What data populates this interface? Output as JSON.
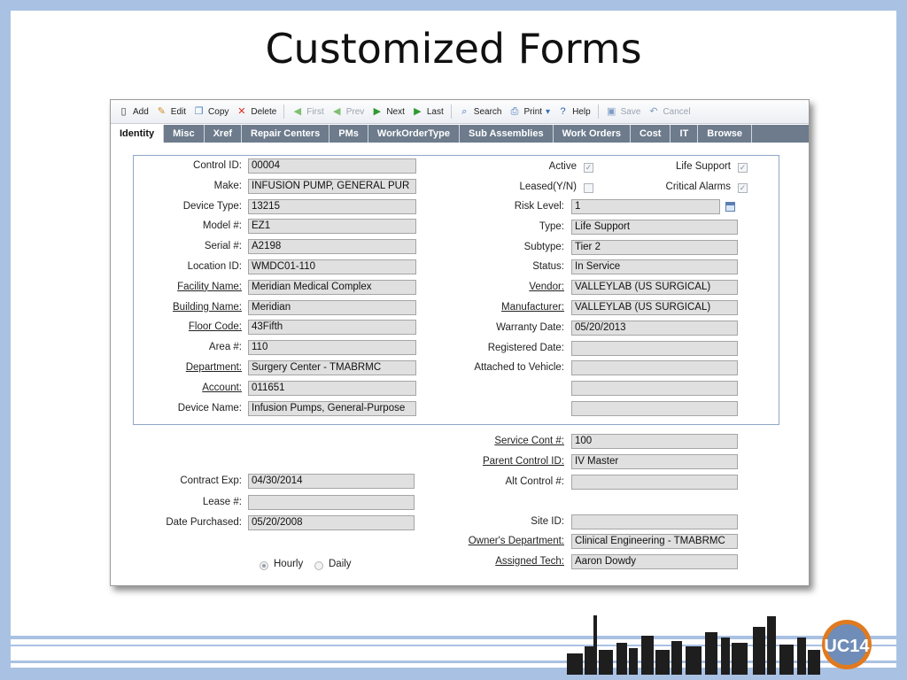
{
  "slide_title": "Customized Forms",
  "toolbar": [
    {
      "label": "Add",
      "icon": "add-icon",
      "glyph": "▯",
      "color": "#333",
      "disabled": false
    },
    {
      "label": "Edit",
      "icon": "edit-icon",
      "glyph": "✎",
      "color": "#d08a1e",
      "disabled": false
    },
    {
      "label": "Copy",
      "icon": "copy-icon",
      "glyph": "❐",
      "color": "#4a7cc0",
      "disabled": false
    },
    {
      "label": "Delete",
      "icon": "delete-icon",
      "glyph": "✕",
      "color": "#e02a1a",
      "disabled": false
    },
    {
      "label": "First",
      "icon": "first-icon",
      "glyph": "◀",
      "color": "#7fbf6f",
      "disabled": true
    },
    {
      "label": "Prev",
      "icon": "prev-icon",
      "glyph": "◀",
      "color": "#7fbf6f",
      "disabled": true
    },
    {
      "label": "Next",
      "icon": "next-icon",
      "glyph": "▶",
      "color": "#2f9a2f",
      "disabled": false
    },
    {
      "label": "Last",
      "icon": "last-icon",
      "glyph": "▶",
      "color": "#2f9a2f",
      "disabled": false
    },
    {
      "label": "Search",
      "icon": "search-icon",
      "glyph": "⌕",
      "color": "#3a6fb5",
      "disabled": false
    },
    {
      "label": "Print",
      "icon": "print-icon",
      "glyph": "⎙",
      "color": "#3a6fb5",
      "disabled": false
    },
    {
      "label": "Help",
      "icon": "help-icon",
      "glyph": "?",
      "color": "#2a5fb0",
      "disabled": false
    },
    {
      "label": "Save",
      "icon": "save-icon",
      "glyph": "▣",
      "color": "#7e9cc6",
      "disabled": true
    },
    {
      "label": "Cancel",
      "icon": "cancel-icon",
      "glyph": "↶",
      "color": "#7e9cc6",
      "disabled": true
    }
  ],
  "print_dropdown_icon": "▾",
  "tabs": [
    "Identity",
    "Misc",
    "Xref",
    "Repair Centers",
    "PMs",
    "WorkOrderType",
    "Sub Assemblies",
    "Work Orders",
    "Cost",
    "IT",
    "Browse"
  ],
  "active_tab": "Identity",
  "left_fields": [
    {
      "label": "Control ID:",
      "value": "00004",
      "link": false
    },
    {
      "label": "Make:",
      "value": "INFUSION PUMP, GENERAL PUR",
      "link": false
    },
    {
      "label": "Device Type:",
      "value": "13215",
      "link": false
    },
    {
      "label": "Model #:",
      "value": "EZ1",
      "link": false
    },
    {
      "label": "Serial #:",
      "value": "A2198",
      "link": false
    },
    {
      "label": "Location ID:",
      "value": "WMDC01-110",
      "link": false
    },
    {
      "label": "Facility Name:",
      "value": "Meridian Medical Complex",
      "link": true
    },
    {
      "label": "Building Name:",
      "value": "Meridian",
      "link": true
    },
    {
      "label": "Floor Code:",
      "value": "43Fifth",
      "link": true
    },
    {
      "label": "Area #:",
      "value": "110",
      "link": false
    },
    {
      "label": "Department:",
      "value": "Surgery Center - TMABRMC",
      "link": true
    },
    {
      "label": "Account:",
      "value": "011651",
      "link": true
    },
    {
      "label": "Device Name:",
      "value": "Infusion Pumps, General-Purpose",
      "link": false
    }
  ],
  "checkboxes": [
    {
      "label": "Active",
      "checked": true
    },
    {
      "label": "Life Support",
      "checked": true
    },
    {
      "label": "Leased(Y/N)",
      "checked": false
    },
    {
      "label": "Critical Alarms",
      "checked": true
    }
  ],
  "right_fields": [
    {
      "label": "Risk Level:",
      "value": "1",
      "link": false
    },
    {
      "label": "Type:",
      "value": "Life Support",
      "link": false
    },
    {
      "label": "Subtype:",
      "value": "Tier 2",
      "link": false
    },
    {
      "label": "Status:",
      "value": "In Service",
      "link": false
    },
    {
      "label": "Vendor:",
      "value": "VALLEYLAB (US SURGICAL)",
      "link": true
    },
    {
      "label": "Manufacturer:",
      "value": "VALLEYLAB (US SURGICAL)",
      "link": true
    },
    {
      "label": "Warranty Date:",
      "value": "05/20/2013",
      "link": false
    },
    {
      "label": "Registered Date:",
      "value": "",
      "link": false
    },
    {
      "label": "Attached to Vehicle:",
      "value": "",
      "link": false
    },
    {
      "label": "",
      "value": "",
      "link": false
    },
    {
      "label": "",
      "value": "",
      "link": false
    }
  ],
  "lower_left": [
    {
      "label": "Contract Exp:",
      "value": "04/30/2014"
    },
    {
      "label": "Lease #:",
      "value": ""
    },
    {
      "label": "Date Purchased:",
      "value": "05/20/2008"
    }
  ],
  "lower_right": [
    {
      "label": "Service Cont #:",
      "value": "100",
      "link": true
    },
    {
      "label": "Parent Control ID:",
      "value": "IV Master",
      "link": true
    },
    {
      "label": "Alt Control #:",
      "value": "",
      "link": false
    },
    {
      "label": "Site ID:",
      "value": "",
      "link": false
    },
    {
      "label": "Owner's Department:",
      "value": "Clinical Engineering - TMABRMC",
      "link": true
    },
    {
      "label": "Assigned Tech:",
      "value": "Aaron Dowdy",
      "link": true
    }
  ],
  "radios": [
    {
      "label": "Hourly",
      "selected": true
    },
    {
      "label": "Daily",
      "selected": false
    }
  ],
  "logo_text": "UC14",
  "colors": {
    "slide_border": "#a9c1e3",
    "tab_bar": "#6d7b8c",
    "field_bg": "#e0e0e0",
    "group_border": "#8fa7c9",
    "logo_orange": "#e07a1f"
  }
}
